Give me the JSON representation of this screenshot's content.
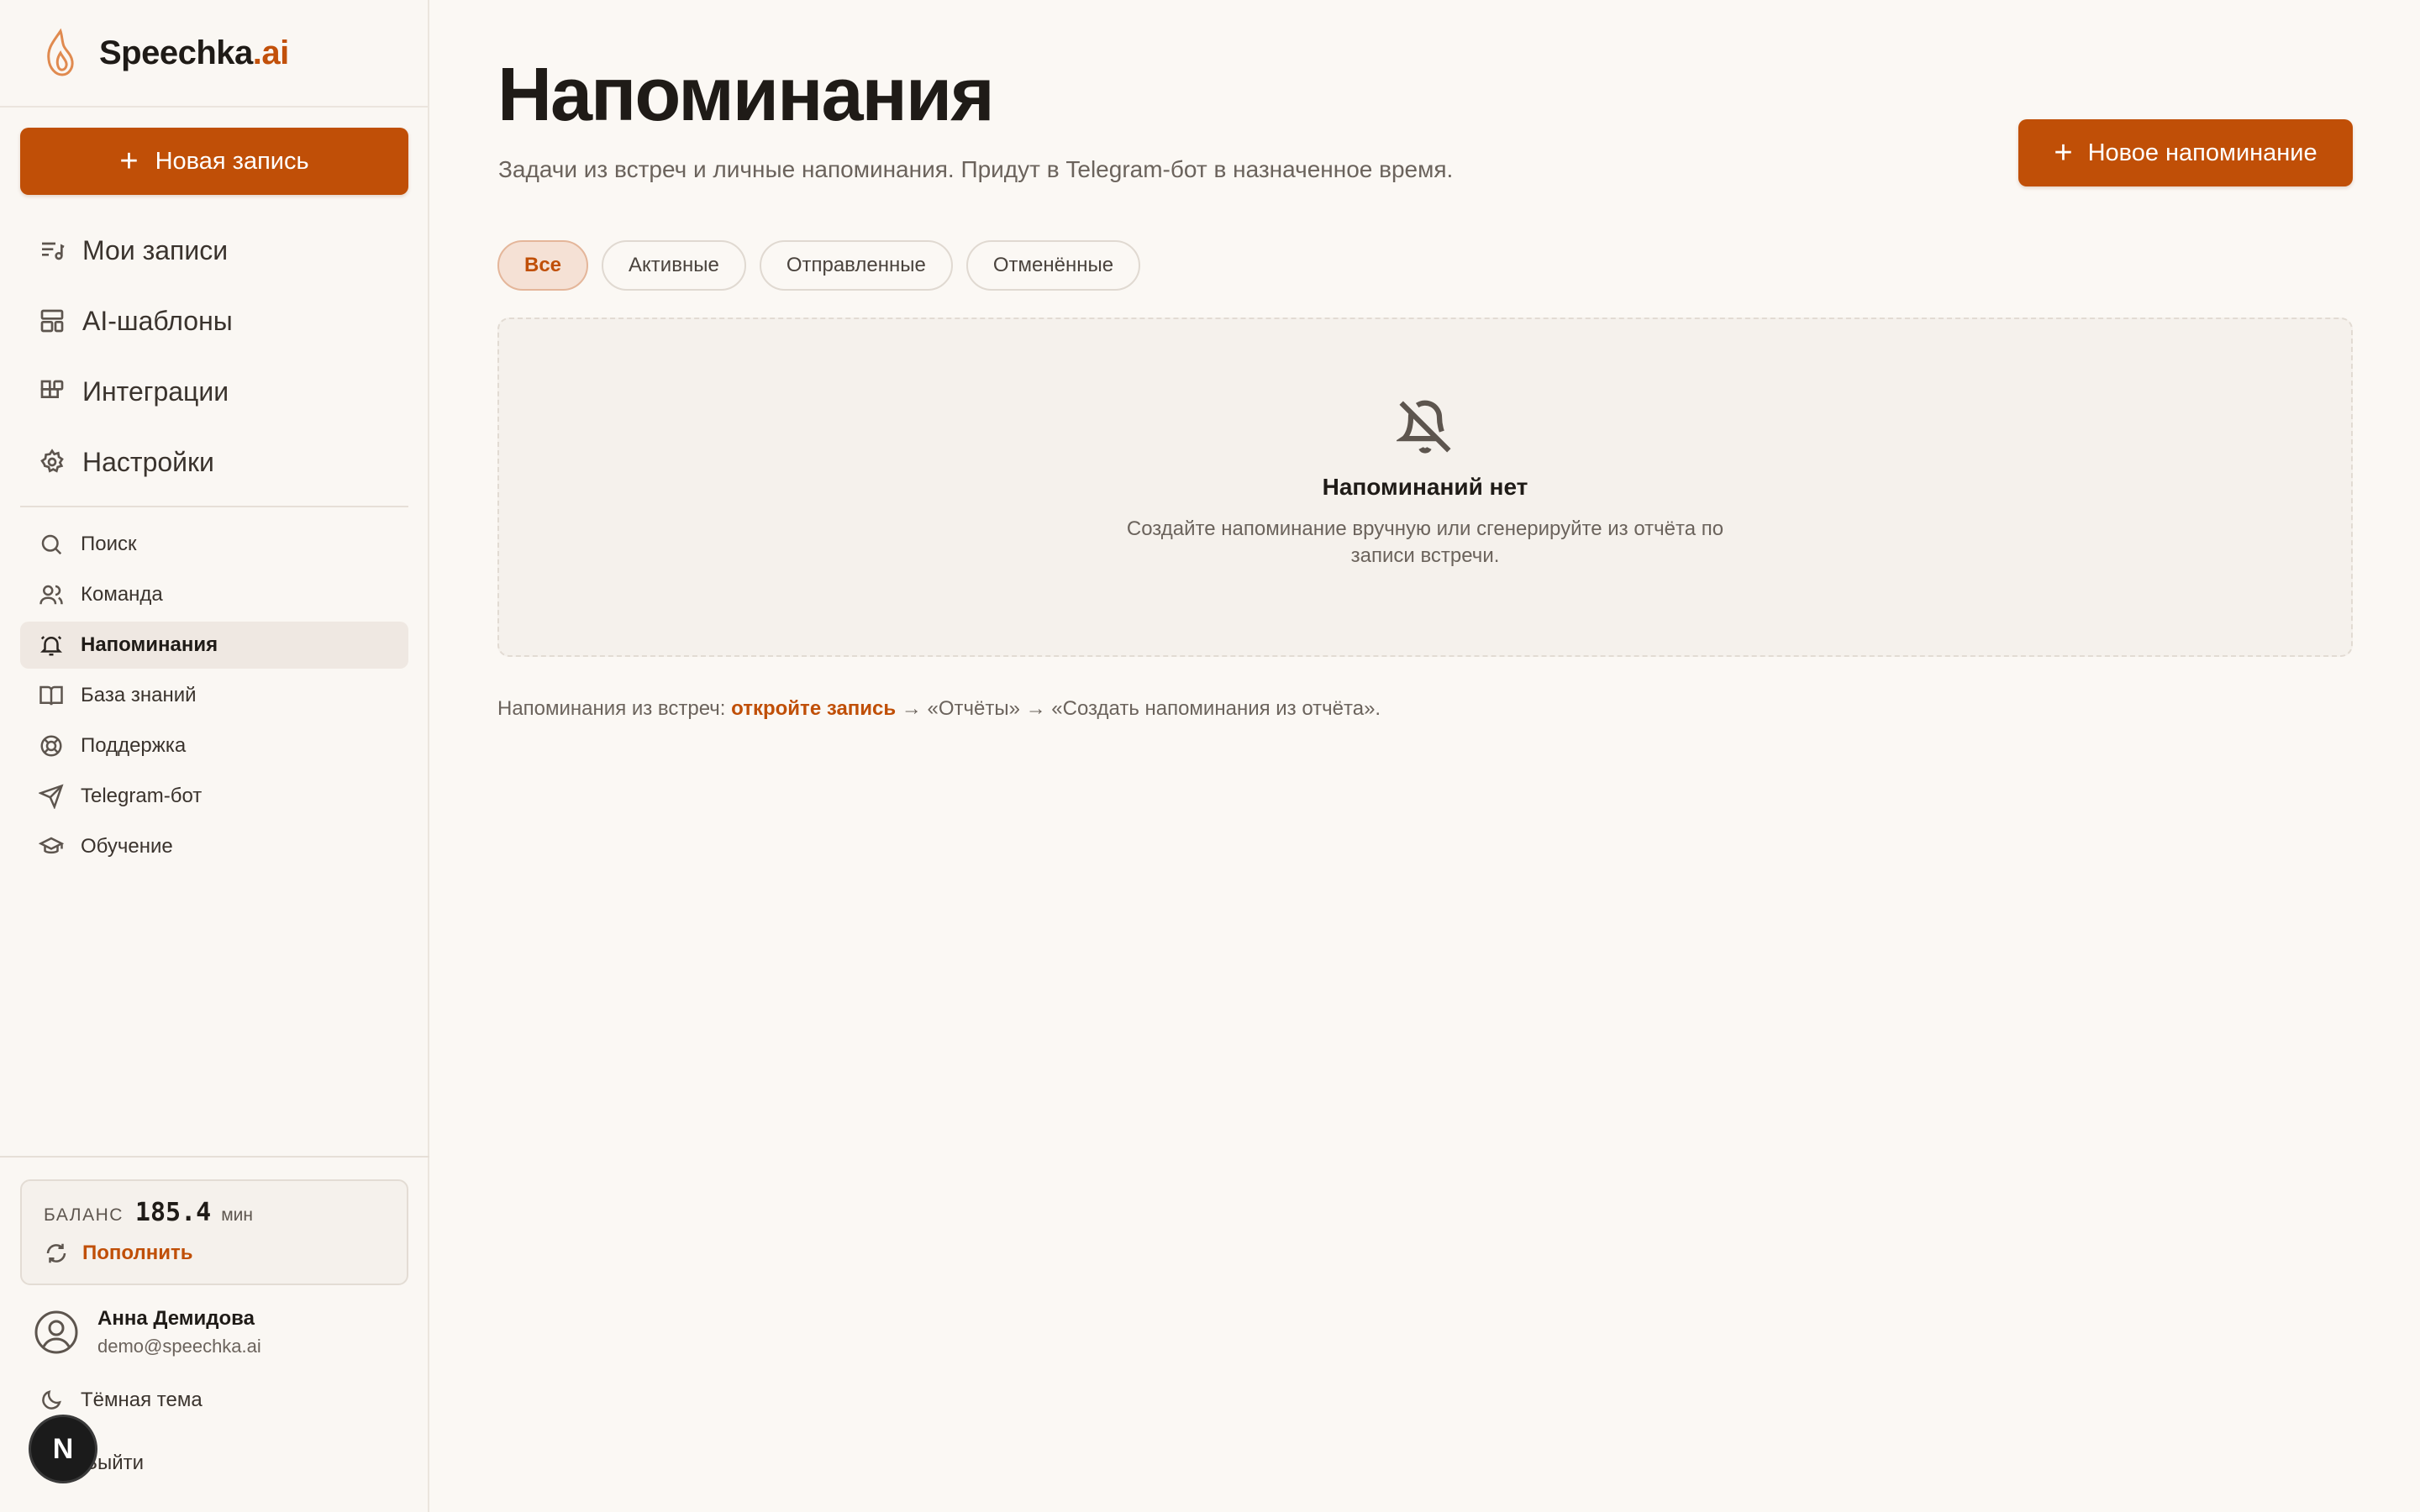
{
  "brand": {
    "name": "Speechka",
    "accent": ".ai"
  },
  "sidebar": {
    "new_record_label": "Новая запись",
    "main_nav": [
      {
        "label": "Мои записи",
        "icon": "list-music-icon"
      },
      {
        "label": "AI-шаблоны",
        "icon": "layout-template-icon"
      },
      {
        "label": "Интеграции",
        "icon": "blocks-icon"
      },
      {
        "label": "Настройки",
        "icon": "gear-icon"
      }
    ],
    "sub_nav": [
      {
        "label": "Поиск",
        "icon": "search-icon"
      },
      {
        "label": "Команда",
        "icon": "users-icon"
      },
      {
        "label": "Напоминания",
        "icon": "bell-icon",
        "active": true
      },
      {
        "label": "База знаний",
        "icon": "book-icon"
      },
      {
        "label": "Поддержка",
        "icon": "lifebuoy-icon"
      },
      {
        "label": "Telegram-бот",
        "icon": "send-icon"
      },
      {
        "label": "Обучение",
        "icon": "graduation-cap-icon"
      }
    ],
    "balance": {
      "label": "БАЛАНС",
      "value": "185.4",
      "unit": "мин",
      "topup_label": "Пополнить"
    },
    "user": {
      "name": "Анна Демидова",
      "email": "demo@speechka.ai"
    },
    "theme_label": "Тёмная тема",
    "logout_label": "Выйти",
    "badge_letter": "N"
  },
  "main": {
    "title": "Напоминания",
    "subtitle": "Задачи из встреч и личные напоминания. Придут в Telegram-бот в назначенное время.",
    "new_reminder_label": "Новое напоминание",
    "filters": [
      {
        "label": "Все",
        "active": true
      },
      {
        "label": "Активные"
      },
      {
        "label": "Отправленные"
      },
      {
        "label": "Отменённые"
      }
    ],
    "empty": {
      "title": "Напоминаний нет",
      "description": "Создайте напоминание вручную или сгенерируйте из отчёта по записи встречи."
    },
    "hint": {
      "prefix": "Напоминания из встреч: ",
      "link": "откройте запись",
      "suffix": " → «Отчёты» → «Создать напоминания из отчёта»."
    }
  },
  "colors": {
    "accent": "#c04f07",
    "background": "#fbf8f4",
    "active_chip_bg": "#f5e1d5"
  }
}
